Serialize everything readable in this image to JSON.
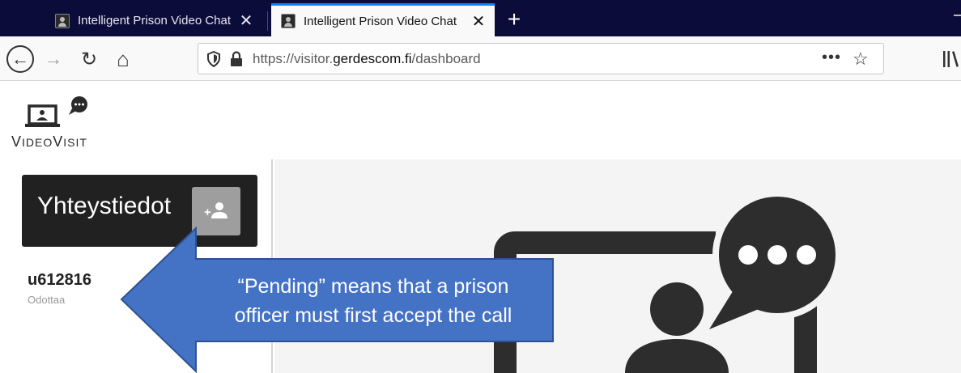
{
  "browser": {
    "tabs": [
      {
        "title": "Intelligent Prison Video Chat",
        "close": "✕"
      },
      {
        "title": "Intelligent Prison Video Chat",
        "close": "✕"
      }
    ],
    "new_tab": "+",
    "nav": {
      "back": "←",
      "forward": "→",
      "reload": "↻",
      "home": "⌂"
    },
    "url": {
      "prefix": "https://visitor.",
      "domain": "gerdescom.fi",
      "path": "/dashboard"
    },
    "page_actions": "•••",
    "bookmark": "☆"
  },
  "app": {
    "logo": {
      "first_cap": "V",
      "first_rest": "IDEO",
      "second_cap": "V",
      "second_rest": "ISIT"
    },
    "contacts_title": "Yhteystiedot",
    "contacts": [
      {
        "name": "u612816",
        "status": "Odottaa"
      }
    ]
  },
  "annotation": {
    "line1": "“Pending” means that a prison",
    "line2": "officer must first accept the call",
    "color": "#4472c4"
  }
}
